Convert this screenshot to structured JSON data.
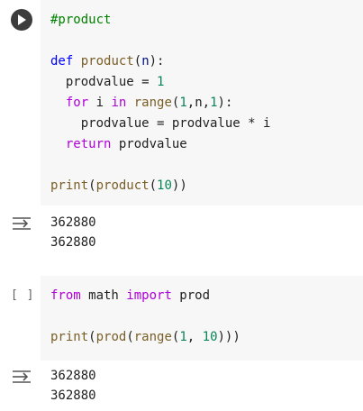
{
  "colors": {
    "cell_background": "#f7f7f7",
    "keyword_control": "#af00db",
    "keyword_def": "#0000ff",
    "function": "#795e26",
    "number": "#098658",
    "comment": "#008000",
    "variable": "#001080"
  },
  "cell1": {
    "run_icon": "play-circle-icon",
    "lines": [
      {
        "tokens": [
          {
            "t": "#product",
            "c": "cm"
          }
        ]
      },
      {
        "tokens": []
      },
      {
        "tokens": [
          {
            "t": "def",
            "c": "kw-blue"
          },
          {
            "t": " ",
            "c": "plain"
          },
          {
            "t": "product",
            "c": "fn"
          },
          {
            "t": "(",
            "c": "plain"
          },
          {
            "t": "n",
            "c": "var"
          },
          {
            "t": "):",
            "c": "plain"
          }
        ]
      },
      {
        "tokens": [
          {
            "t": "  prodvalue = ",
            "c": "plain"
          },
          {
            "t": "1",
            "c": "num"
          }
        ]
      },
      {
        "tokens": [
          {
            "t": "  ",
            "c": "plain"
          },
          {
            "t": "for",
            "c": "kw-purple"
          },
          {
            "t": " i ",
            "c": "plain"
          },
          {
            "t": "in",
            "c": "kw-purple"
          },
          {
            "t": " ",
            "c": "plain"
          },
          {
            "t": "range",
            "c": "fn"
          },
          {
            "t": "(",
            "c": "plain"
          },
          {
            "t": "1",
            "c": "num"
          },
          {
            "t": ",n,",
            "c": "plain"
          },
          {
            "t": "1",
            "c": "num"
          },
          {
            "t": "):",
            "c": "plain"
          }
        ]
      },
      {
        "tokens": [
          {
            "t": "    prodvalue = prodvalue * i",
            "c": "plain"
          }
        ]
      },
      {
        "tokens": [
          {
            "t": "  ",
            "c": "plain"
          },
          {
            "t": "return",
            "c": "kw-purple"
          },
          {
            "t": " prodvalue",
            "c": "plain"
          }
        ]
      },
      {
        "tokens": []
      },
      {
        "tokens": [
          {
            "t": "print",
            "c": "fn"
          },
          {
            "t": "(",
            "c": "plain"
          },
          {
            "t": "product",
            "c": "fn"
          },
          {
            "t": "(",
            "c": "plain"
          },
          {
            "t": "10",
            "c": "num"
          },
          {
            "t": "))",
            "c": "plain"
          }
        ]
      }
    ],
    "output_icon": "output-toggle-icon",
    "output": [
      "362880",
      "362880"
    ]
  },
  "cell2": {
    "exec_count": "[ ]",
    "lines": [
      {
        "tokens": [
          {
            "t": "from",
            "c": "kw-purple"
          },
          {
            "t": " math ",
            "c": "plain"
          },
          {
            "t": "import",
            "c": "kw-purple"
          },
          {
            "t": " prod",
            "c": "plain"
          }
        ]
      },
      {
        "tokens": []
      },
      {
        "tokens": [
          {
            "t": "print",
            "c": "fn"
          },
          {
            "t": "(",
            "c": "plain"
          },
          {
            "t": "prod",
            "c": "fn"
          },
          {
            "t": "(",
            "c": "plain"
          },
          {
            "t": "range",
            "c": "fn"
          },
          {
            "t": "(",
            "c": "plain"
          },
          {
            "t": "1",
            "c": "num"
          },
          {
            "t": ", ",
            "c": "plain"
          },
          {
            "t": "10",
            "c": "num"
          },
          {
            "t": ")))",
            "c": "plain"
          }
        ]
      }
    ],
    "output_icon": "output-toggle-icon",
    "output": [
      "362880",
      "362880"
    ]
  }
}
